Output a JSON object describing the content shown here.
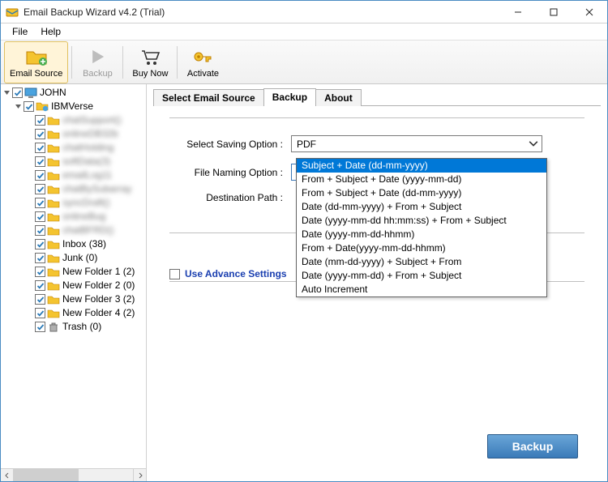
{
  "title": "Email Backup Wizard v4.2 (Trial)",
  "menu": {
    "file": "File",
    "help": "Help"
  },
  "toolbar": {
    "emailSource": "Email Source",
    "backup": "Backup",
    "buyNow": "Buy Now",
    "activate": "Activate"
  },
  "tree": {
    "root": "JOHN",
    "ibm": "IBMVerse",
    "inbox": "Inbox (38)",
    "junk": "Junk (0)",
    "nf1": "New Folder 1 (2)",
    "nf2": "New Folder 2 (0)",
    "nf3": "New Folder 3 (2)",
    "nf4": "New Folder 4 (2)",
    "trash": "Trash (0)",
    "blur": [
      "chatSupport()",
      "onlineDB32b",
      "chatHolding",
      "softData(3)",
      "emailLog11",
      "chatBySubarray",
      "syncDraft()",
      "onlineBug",
      "chatBFRD()"
    ]
  },
  "tabs": {
    "select": "Select Email Source",
    "backup": "Backup",
    "about": "About"
  },
  "form": {
    "saving": "Select Saving Option :",
    "savingValue": "PDF",
    "naming": "File Naming Option :",
    "namingValue": "Subject + Date (dd-mm-yyyy)",
    "dest": "Destination Path :",
    "advance": "Use Advance Settings"
  },
  "dropdown": {
    "options": [
      "Subject + Date (dd-mm-yyyy)",
      "From + Subject + Date (yyyy-mm-dd)",
      "From + Subject + Date (dd-mm-yyyy)",
      "Date (dd-mm-yyyy) + From + Subject",
      "Date (yyyy-mm-dd hh:mm:ss) + From + Subject",
      "Date (yyyy-mm-dd-hhmm)",
      "From + Date(yyyy-mm-dd-hhmm)",
      "Date (mm-dd-yyyy) + Subject + From",
      "Date (yyyy-mm-dd) + From + Subject",
      "Auto Increment"
    ]
  },
  "buttons": {
    "backup": "Backup"
  }
}
